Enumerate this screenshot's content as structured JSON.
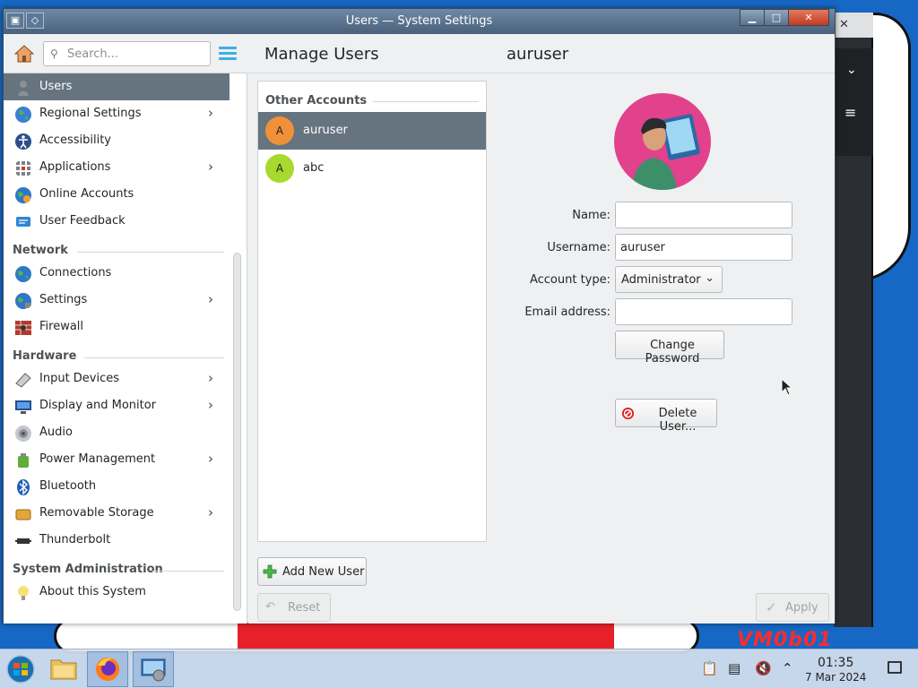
{
  "window": {
    "title": "Users — System Settings",
    "minimize_glyph": "▁",
    "maximize_glyph": "□",
    "close_glyph": "✕"
  },
  "search": {
    "placeholder": "Search..."
  },
  "sidebar": {
    "items": [
      {
        "label": "Users",
        "icon": "users-icon",
        "active": true,
        "chevron": false
      },
      {
        "label": "Regional Settings",
        "icon": "regional-settings-icon",
        "chevron": true
      },
      {
        "label": "Accessibility",
        "icon": "accessibility-icon",
        "chevron": false
      },
      {
        "label": "Applications",
        "icon": "applications-icon",
        "chevron": true
      },
      {
        "label": "Online Accounts",
        "icon": "online-accounts-icon",
        "chevron": false
      },
      {
        "label": "User Feedback",
        "icon": "user-feedback-icon",
        "chevron": false
      }
    ],
    "network_heading": "Network",
    "network": [
      {
        "label": "Connections",
        "icon": "connections-icon",
        "chevron": false
      },
      {
        "label": "Settings",
        "icon": "network-settings-icon",
        "chevron": true
      },
      {
        "label": "Firewall",
        "icon": "firewall-icon",
        "chevron": false
      }
    ],
    "hardware_heading": "Hardware",
    "hardware": [
      {
        "label": "Input Devices",
        "icon": "input-devices-icon",
        "chevron": true
      },
      {
        "label": "Display and Monitor",
        "icon": "display-icon",
        "chevron": true
      },
      {
        "label": "Audio",
        "icon": "audio-icon",
        "chevron": false
      },
      {
        "label": "Power Management",
        "icon": "power-icon",
        "chevron": true
      },
      {
        "label": "Bluetooth",
        "icon": "bluetooth-icon",
        "chevron": false
      },
      {
        "label": "Removable Storage",
        "icon": "removable-storage-icon",
        "chevron": true
      },
      {
        "label": "Thunderbolt",
        "icon": "thunderbolt-icon",
        "chevron": false
      }
    ],
    "sysadmin_heading": "System Administration",
    "sysadmin": [
      {
        "label": "About this System",
        "icon": "about-system-icon",
        "chevron": false
      }
    ],
    "chevron_glyph": "›"
  },
  "main": {
    "page_title": "Manage Users",
    "selected_user": "auruser",
    "accounts_heading": "Other Accounts",
    "accounts": [
      {
        "initial": "A",
        "name": "auruser",
        "color": "#f0913a",
        "selected": true
      },
      {
        "initial": "A",
        "name": "abc",
        "color": "#a8d92e",
        "selected": false
      }
    ],
    "form": {
      "name_label": "Name:",
      "name_value": "",
      "username_label": "Username:",
      "username_value": "auruser",
      "account_type_label": "Account type:",
      "account_type_value": "Administrator",
      "email_label": "Email address:",
      "email_value": "",
      "change_password": "Change Password",
      "delete_user": "Delete User..."
    },
    "add_user": "Add New User",
    "reset": "Reset",
    "apply": "Apply"
  },
  "taskbar": {
    "time": "01:35",
    "date": "7 Mar 2024"
  },
  "desktop": {
    "watermark": "VM0b01"
  },
  "colors": {
    "accent": "#3daee9",
    "selection": "#667480",
    "avatar_bg": "#e2418c",
    "desktop": "#1767c4"
  }
}
